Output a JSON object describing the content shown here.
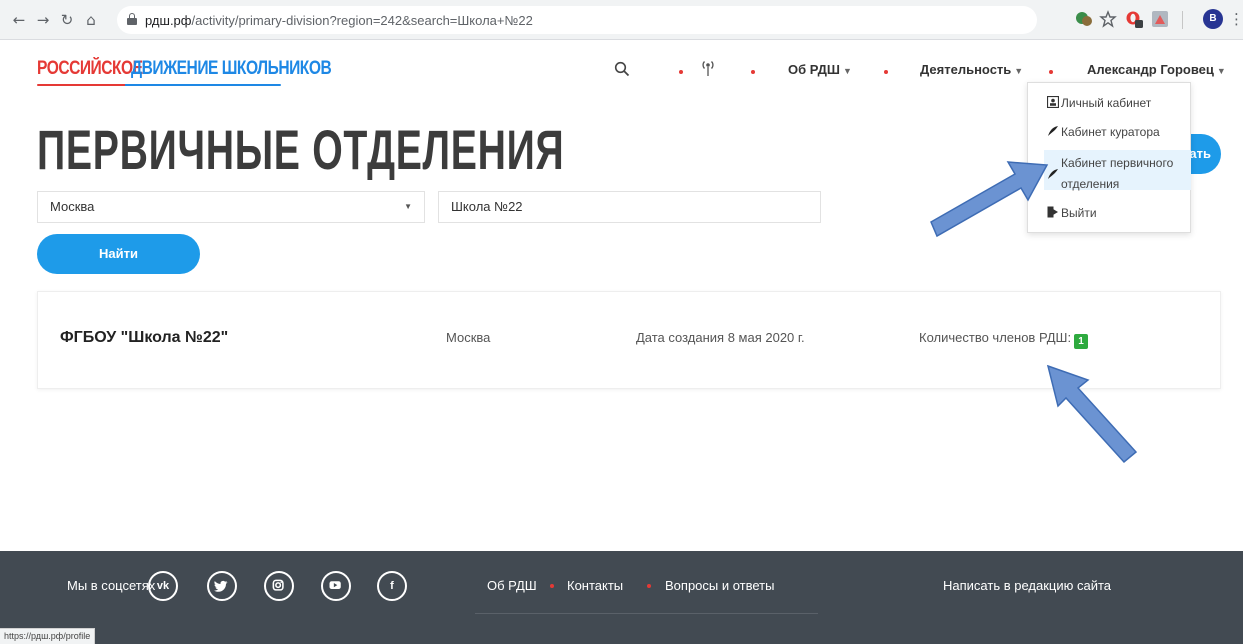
{
  "browser": {
    "url_host": "рдш.рф",
    "url_path": "/activity/primary-division?region=242&search=Школа+№22",
    "profile_initial": "В"
  },
  "header": {
    "logo_word1": "РОССИЙСКОЕ",
    "logo_word2": "ДВИЖЕНИЕ ШКОЛЬНИКОВ",
    "nav": {
      "about": "Об РДШ",
      "activity": "Деятельность",
      "user": "Александр Горовец"
    }
  },
  "main": {
    "title": "ПЕРВИЧНЫЕ ОТДЕЛЕНИЯ",
    "register_button": "Зарегистрировать",
    "region_select_value": "Москва",
    "search_value": "Школа №22",
    "find_button": "Найти",
    "result": {
      "name": "ФГБОУ \"Школа №22\"",
      "city": "Москва",
      "date": "Дата создания 8 мая 2020 г.",
      "members_label": "Количество членов РДШ:",
      "members_count": "1"
    }
  },
  "user_menu": {
    "items": [
      {
        "label": "Личный кабинет",
        "icon": "profile-card-icon"
      },
      {
        "label": "Кабинет куратора",
        "icon": "feather-icon"
      },
      {
        "label_line1": "Кабинет первичного",
        "label_line2": "отделения",
        "icon": "feather-icon"
      },
      {
        "label": "Выйти",
        "icon": "logout-icon"
      }
    ]
  },
  "footer": {
    "social_label": "Мы в соцсетях",
    "social": [
      {
        "name": "vk-icon",
        "glyph": "vk"
      },
      {
        "name": "twitter-icon",
        "glyph": ""
      },
      {
        "name": "instagram-icon",
        "glyph": ""
      },
      {
        "name": "youtube-icon",
        "glyph": ""
      },
      {
        "name": "facebook-icon",
        "glyph": "f"
      }
    ],
    "links": [
      "Об РДШ",
      "Контакты",
      "Вопросы и ответы"
    ],
    "write": "Написать в редакцию сайта"
  },
  "status_bar_url": "https://рдш.рф/profile",
  "colors": {
    "accent_blue": "#1e9be9",
    "brand_red": "#e53935",
    "footer_bg": "#424a52",
    "badge_green": "#2eaa3f",
    "annotation_arrow": "#6b93d2"
  }
}
